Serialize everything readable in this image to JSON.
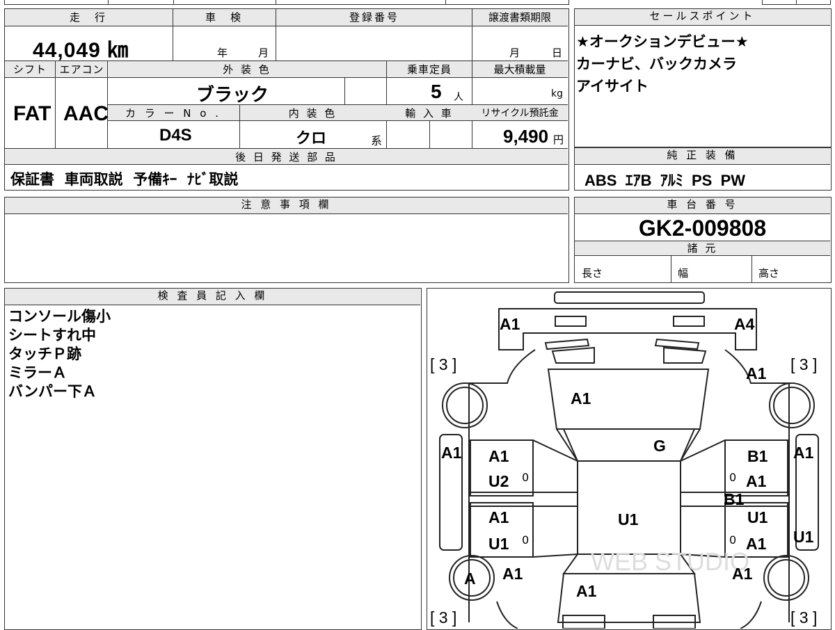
{
  "main_table": {
    "mileage_label": "走　行",
    "mileage_value": "44,049 ㎞",
    "inspection_label": "車　検",
    "inspection_year": "年",
    "inspection_month": "月",
    "registration_label": "登録番号",
    "transfer_label": "譲渡書類期限",
    "transfer_month": "月",
    "transfer_day": "日",
    "shift_label": "シフト",
    "shift_value": "FAT",
    "ac_label": "エアコン",
    "ac_value": "AAC",
    "exterior_color_label": "外 装 色",
    "exterior_color_value": "ブラック",
    "capacity_label": "乗車定員",
    "capacity_value": "5",
    "capacity_unit": "人",
    "max_load_label": "最大積載量",
    "max_load_unit": "kg",
    "color_no_label": "カ ラ ー N o .",
    "color_no_value": "D4S",
    "interior_color_label": "内 装 色",
    "interior_color_value": "クロ",
    "interior_color_suffix": "系",
    "import_label": "輸 入 車",
    "recycle_label": "リサイクル預託金",
    "recycle_value": "9,490",
    "recycle_unit": "円",
    "later_parts_label": "後 日 発 送 部 品",
    "later_parts_value": "保証書  車両取説  予備ｷｰ  ﾅﾋﾞ取説"
  },
  "sales_points": {
    "label": "セールスポイント",
    "lines": [
      "★オークションデビュー★",
      "カーナビ、バックカメラ",
      "アイサイト"
    ]
  },
  "standard_equipment": {
    "label": "純 正 装 備",
    "value": "ABS  ｴｱB  ｱﾙﾐ  PS  PW"
  },
  "notes": {
    "label": "注 意 事 項 欄"
  },
  "chassis": {
    "label": "車 台 番 号",
    "value": "GK2-009808",
    "specs_label": "諸 元",
    "length_label": "長さ",
    "width_label": "幅",
    "height_label": "高さ"
  },
  "inspector": {
    "label": "検 査 員 記 入 欄",
    "lines": [
      "コンソール傷小",
      "シートすれ中",
      "タッチＰ跡",
      "ミラーＡ",
      "バンパー下Ａ"
    ]
  },
  "diagram": {
    "watermark": "WEB STUDIO",
    "tires": [
      "[ 3 ]",
      "[ 3 ]",
      "[ 3 ]",
      "[ 3 ]"
    ],
    "marks": {
      "front_left": "A1",
      "front_right": "A4",
      "fender_right": "A1",
      "hood": "A1",
      "windshield": "G",
      "left_side": "A1",
      "right_side": "A1",
      "door_fl_a": "A1",
      "door_fl_b": "U2",
      "door_rl_a": "A1",
      "door_rl_b": "U1",
      "door_fr_a": "B1",
      "door_fr_b": "A1",
      "door_fr_c": "B1",
      "door_rr_a": "U1",
      "door_rr_b": "A1",
      "roof": "U1",
      "right_rear_side": "U1",
      "rear_wheel_left": "A",
      "rear_left": "A1",
      "rear_right": "A1",
      "trunk": "A1",
      "zero": "0"
    }
  }
}
